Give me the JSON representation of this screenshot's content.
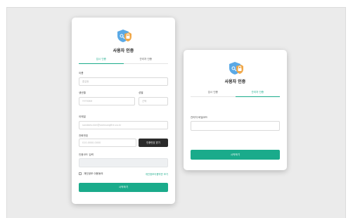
{
  "colors": {
    "accent": "#1aab8b",
    "dark_button": "#2a2a2a",
    "background": "#ebebeb"
  },
  "left_card": {
    "logo": "shield-lock-icon",
    "title": "사용자 인증",
    "tabs": [
      {
        "label": "임시 인증",
        "active": true
      },
      {
        "label": "관리자 인증",
        "active": false
      }
    ],
    "name_label": "이름",
    "name_placeholder": "홍길동",
    "birth_label": "생년월",
    "birth_placeholder": "YYYYMM",
    "gender_label": "성별",
    "gender_placeholder": "선택",
    "email_label": "이메일",
    "email_placeholder": "sanddev.kim@samsungfire.co.kr",
    "phone_label": "전화번호",
    "phone_placeholder": "010-0000-0000",
    "auth_request_button": "인증번호 받기",
    "auth_code_label": "인증코드 입력",
    "consent_label": "개인정보 이용동의",
    "consent_link": "개인정보이용약관 보기",
    "start_button": "시작하기"
  },
  "right_card": {
    "logo": "shield-lock-icon",
    "title": "사용자 인증",
    "tabs": [
      {
        "label": "임시 인증",
        "active": false
      },
      {
        "label": "관리자 인증",
        "active": true
      }
    ],
    "admin_code_label": "관리자 비밀코드",
    "start_button": "시작하기"
  }
}
